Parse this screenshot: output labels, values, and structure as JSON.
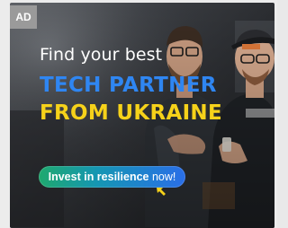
{
  "ad": {
    "badge": "AD",
    "intro": "Find your best",
    "headline_line1": "TECH PARTNER",
    "headline_line2": "FROM UKRAINE",
    "cta_strong": "Invest in resilience",
    "cta_rest": " now!",
    "colors": {
      "headline_blue": "#2f86f2",
      "headline_yellow": "#f6d21a",
      "cta_gradient_start": "#1fa96e",
      "cta_gradient_end": "#2a6ee8",
      "cursor": "#f6d21a"
    },
    "icons": [
      "cursor-arrow-icon"
    ],
    "photo": "two-men-standing-smiling"
  }
}
